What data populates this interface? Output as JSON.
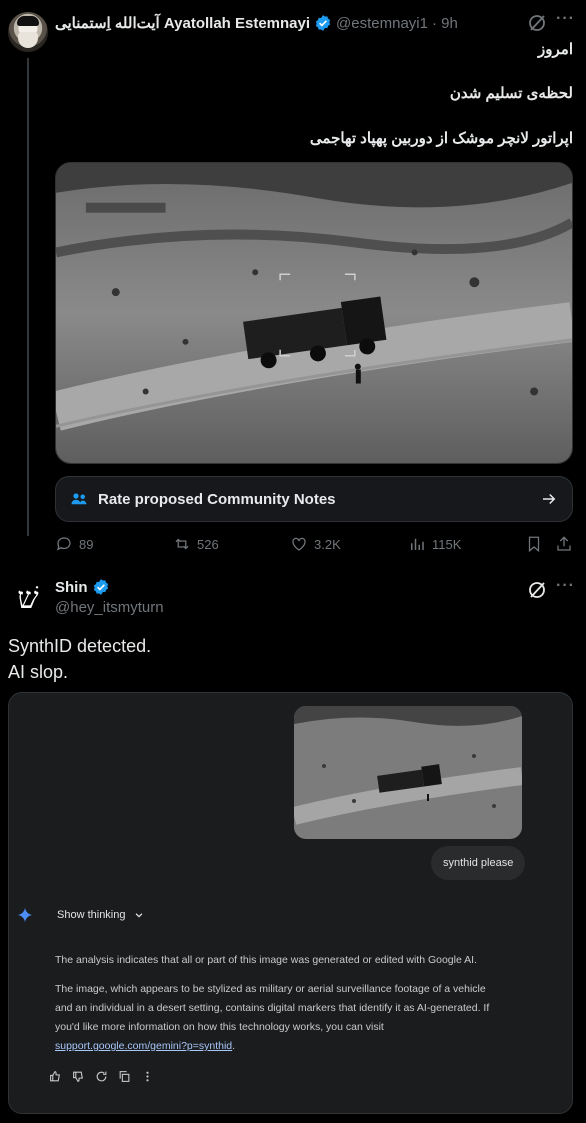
{
  "tweet1": {
    "display_name": "آیت‌الله اِستمنایی Ayatollah Estemnayi",
    "handle": "@estemnayi1",
    "time": "· 9h",
    "lines": [
      "امروز",
      "لحظه‌ی تسلیم شدن",
      "اپراتور لانچر موشک از دوربین پهپاد تهاجمی"
    ],
    "community_notes_label": "Rate proposed Community Notes",
    "stats": {
      "replies": "89",
      "reposts": "526",
      "likes": "3.2K",
      "views": "115K"
    }
  },
  "tweet2": {
    "display_name": "Shin",
    "avatar_glyph": "שׁ",
    "handle": "@hey_itsmyturn",
    "text_lines": [
      "SynthID detected.",
      "AI slop."
    ]
  },
  "gemini": {
    "user_prompt": "synthid please",
    "show_thinking": "Show thinking",
    "para1": "The analysis indicates that all or part of this image was generated or edited with Google AI.",
    "para2_lines": [
      "The image, which appears to be stylized as military or aerial surveillance footage of a vehicle",
      "and an individual in a desert setting, contains digital markers that identify it as AI-generated. If",
      "you'd like more information on how this technology works, you can visit"
    ],
    "link": "support.google.com/gemini?p=synthid",
    "link_suffix": "."
  },
  "colors": {
    "verified": "#1d9bf0",
    "muted": "#71767b",
    "link": "#a8c7fa",
    "gemini_star": "#4c8df6"
  },
  "icons": [
    "verified-badge-icon",
    "grok-icon",
    "more-icon",
    "community-notes-icon",
    "arrow-right-icon",
    "reply-icon",
    "repost-icon",
    "like-icon",
    "views-icon",
    "bookmark-icon",
    "share-icon",
    "gemini-star-icon",
    "chevron-down-icon",
    "thumbs-up-icon",
    "thumbs-down-icon",
    "regenerate-icon",
    "copy-icon"
  ]
}
